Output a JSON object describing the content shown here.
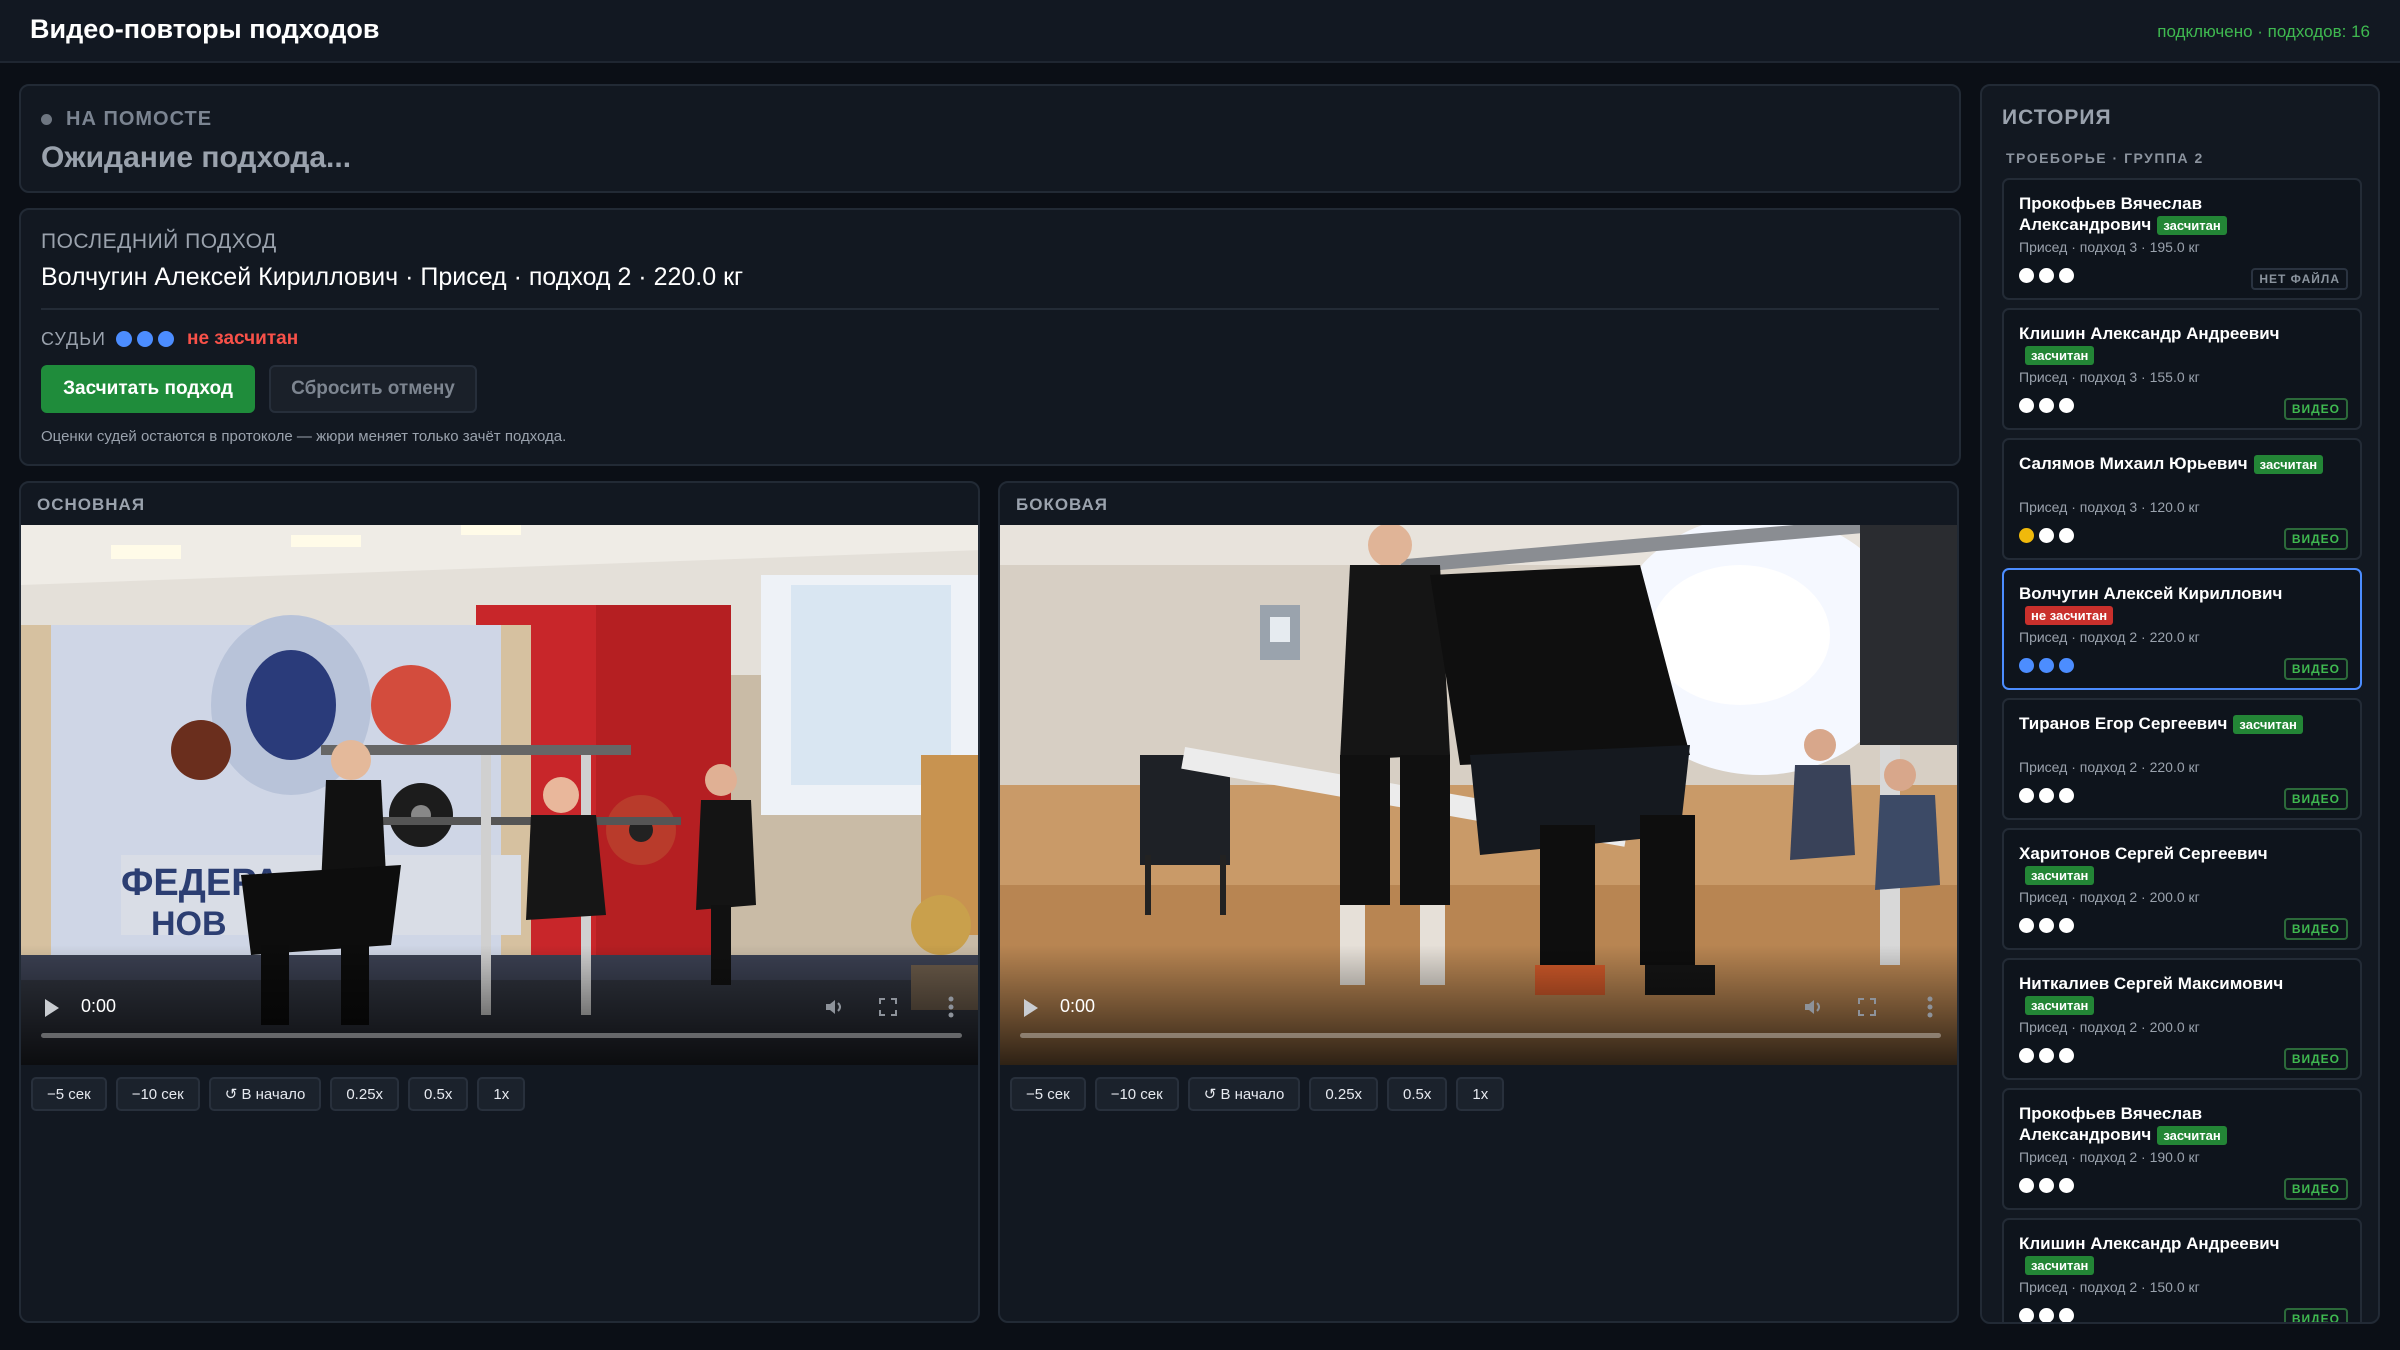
{
  "header": {
    "title": "Видео-повторы подходов",
    "status": "подключено · подходов: 16"
  },
  "platform": {
    "label": "НА ПОМОСТЕ",
    "status": "Ожидание подхода..."
  },
  "last_attempt": {
    "label": "ПОСЛЕДНИЙ ПОДХОД",
    "text": "Волчугин Алексей Кириллович · Присед · подход 2 · 220.0 кг",
    "judges_label": "СУДЬИ",
    "judges": [
      "blue",
      "blue",
      "blue"
    ],
    "verdict": "не засчитан",
    "accept_button": "Засчитать подход",
    "reset_button": "Сбросить отмену",
    "note": "Оценки судей остаются в протоколе — жюри меняет только зачёт подхода."
  },
  "videos": {
    "main": {
      "label": "ОСНОВНАЯ",
      "time": "0:00",
      "controls": [
        "−5 сек",
        "−10 сек",
        "↺ В начало",
        "0.25x",
        "0.5x",
        "1x"
      ]
    },
    "side": {
      "label": "БОКОВАЯ",
      "time": "0:00",
      "controls": [
        "−5 сек",
        "−10 сек",
        "↺ В начало",
        "0.25x",
        "0.5x",
        "1x"
      ]
    }
  },
  "history": {
    "title": "ИСТОРИЯ",
    "subtitle": "ТРОЕБОРЬЕ · ГРУППА 2",
    "colors": {
      "white": "#ffffff",
      "yellow": "#f0b90b",
      "blue": "#4c8dff"
    },
    "items": [
      {
        "name": "Прокофьев Вячеслав Александрович",
        "status": "засчитан",
        "ok": true,
        "info": "Присед · подход 3 · 195.0 кг",
        "judges": [
          "white",
          "white",
          "white"
        ],
        "tag": "НЕТ ФАЙЛА",
        "video": false,
        "selected": false
      },
      {
        "name": "Клишин Александр Андреевич",
        "status": "засчитан",
        "ok": true,
        "info": "Присед · подход 3 · 155.0 кг",
        "judges": [
          "white",
          "white",
          "white"
        ],
        "tag": "ВИДЕО",
        "video": true,
        "selected": false
      },
      {
        "name": "Салямов Михаил Юрьевич",
        "status": "засчитан",
        "ok": true,
        "info": "Присед · подход 3 · 120.0 кг",
        "judges": [
          "yellow",
          "white",
          "white"
        ],
        "tag": "ВИДЕО",
        "video": true,
        "selected": false
      },
      {
        "name": "Волчугин Алексей Кириллович",
        "status": "не засчитан",
        "ok": false,
        "info": "Присед · подход 2 · 220.0 кг",
        "judges": [
          "blue",
          "blue",
          "blue"
        ],
        "tag": "ВИДЕО",
        "video": true,
        "selected": true
      },
      {
        "name": "Тиранов Егор Сергеевич",
        "status": "засчитан",
        "ok": true,
        "info": "Присед · подход 2 · 220.0 кг",
        "judges": [
          "white",
          "white",
          "white"
        ],
        "tag": "ВИДЕО",
        "video": true,
        "selected": false
      },
      {
        "name": "Харитонов Сергей Сергеевич",
        "status": "засчитан",
        "ok": true,
        "info": "Присед · подход 2 · 200.0 кг",
        "judges": [
          "white",
          "white",
          "white"
        ],
        "tag": "ВИДЕО",
        "video": true,
        "selected": false
      },
      {
        "name": "Ниткалиев Сергей Максимович",
        "status": "засчитан",
        "ok": true,
        "info": "Присед · подход 2 · 200.0 кг",
        "judges": [
          "white",
          "white",
          "white"
        ],
        "tag": "ВИДЕО",
        "video": true,
        "selected": false
      },
      {
        "name": "Прокофьев Вячеслав Александрович",
        "status": "засчитан",
        "ok": true,
        "info": "Присед · подход 2 · 190.0 кг",
        "judges": [
          "white",
          "white",
          "white"
        ],
        "tag": "ВИДЕО",
        "video": true,
        "selected": false
      },
      {
        "name": "Клишин Александр Андреевич",
        "status": "засчитан",
        "ok": true,
        "info": "Присед · подход 2 · 150.0 кг",
        "judges": [
          "white",
          "white",
          "white"
        ],
        "tag": "ВИДЕО",
        "video": true,
        "selected": false
      }
    ]
  }
}
